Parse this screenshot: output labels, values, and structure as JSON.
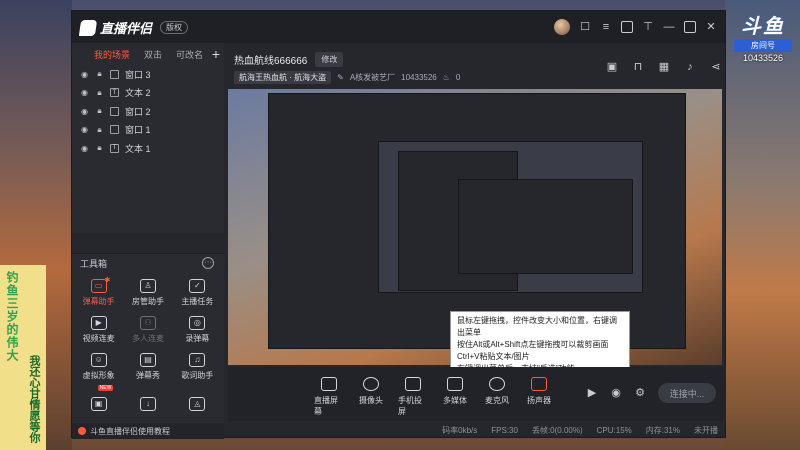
{
  "app": {
    "title": "直播伴侣",
    "version_pill": "版权"
  },
  "brand": {
    "logo": "斗鱼",
    "sub": "房间号",
    "room": "10433526"
  },
  "side_banner": {
    "text1": "钓鱼三岁的伟大",
    "text2": "我还心甘情愿等你"
  },
  "scenes": {
    "tabs": [
      "我的场景",
      "双击",
      "可改名"
    ],
    "add_label": "+",
    "sources": [
      {
        "type": "window",
        "label": "窗口 3"
      },
      {
        "type": "text",
        "label": "文本 2"
      },
      {
        "type": "window",
        "label": "窗口 2"
      },
      {
        "type": "window",
        "label": "窗口 1"
      },
      {
        "type": "text",
        "label": "文本 1"
      }
    ]
  },
  "toolbox": {
    "title": "工具箱",
    "more": "···",
    "tools": [
      {
        "label": "弹幕助手",
        "icon": "danmu-icon",
        "state": "active"
      },
      {
        "label": "房管助手",
        "icon": "admin-icon",
        "state": "normal"
      },
      {
        "label": "主播任务",
        "icon": "task-icon",
        "state": "normal"
      },
      {
        "label": "视频连麦",
        "icon": "video-link-icon",
        "state": "normal"
      },
      {
        "label": "多人连麦",
        "icon": "multi-link-icon",
        "state": "dim"
      },
      {
        "label": "录弹幕",
        "icon": "record-icon",
        "state": "normal"
      },
      {
        "label": "虚拟形象",
        "icon": "avatar-icon",
        "state": "normal"
      },
      {
        "label": "弹幕秀",
        "icon": "danmu-show-icon",
        "state": "normal"
      },
      {
        "label": "歌词助手",
        "icon": "lyrics-icon",
        "state": "normal"
      },
      {
        "label": "",
        "icon": "gift-icon",
        "state": "normal",
        "badge": "NEW"
      },
      {
        "label": "",
        "icon": "download-icon",
        "state": "normal"
      },
      {
        "label": "",
        "icon": "car-icon",
        "state": "normal"
      }
    ]
  },
  "footer_tip": "斗鱼直播伴侣使用教程",
  "stream": {
    "title": "热血航线666666",
    "edit_label": "修改",
    "category": "航海王热血航 · 航海大盗",
    "studio": "A核发被艺厂",
    "room": "10433526",
    "viewers": "0"
  },
  "tooltip": {
    "lines": [
      "鼠标左键拖拽，控件改变大小和位置，右键调出菜单",
      "按住Alt或Alt+Shift点左键拖拽可以裁剪画面",
      "Ctrl+V粘贴文本/图片",
      "右键调出菜单后，支持\"反选\"功能"
    ]
  },
  "bottombar": {
    "tools": [
      {
        "label": "直播屏幕",
        "icon": "screen-icon"
      },
      {
        "label": "摄像头",
        "icon": "camera-icon"
      },
      {
        "label": "手机投屏",
        "icon": "phone-cast-icon"
      },
      {
        "label": "多媒体",
        "icon": "media-icon"
      },
      {
        "label": "麦克风",
        "icon": "mic-icon"
      },
      {
        "label": "扬声器",
        "icon": "speaker-icon"
      }
    ],
    "live_button": "连接中..."
  },
  "status": {
    "bitrate": "码率0kb/s",
    "fps": "FPS:30",
    "drop": "丢帧:0(0.00%)",
    "cpu": "CPU:15%",
    "mem": "内存:31%",
    "network": "未开播"
  }
}
